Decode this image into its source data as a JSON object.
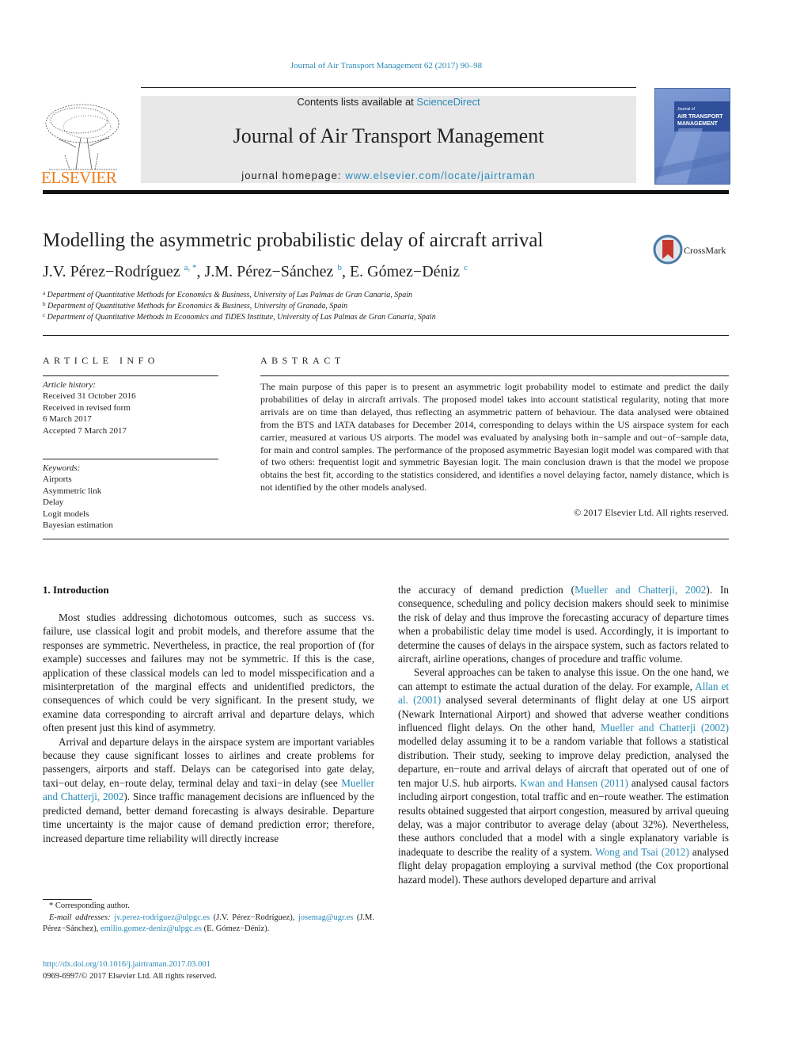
{
  "header": {
    "running_head": "Journal of Air Transport Management 62 (2017) 90–98",
    "contents_prefix": "Contents lists available at ",
    "contents_link": "ScienceDirect",
    "journal_title": "Journal of Air Transport Management",
    "homepage_prefix": "journal homepage: ",
    "homepage_link": "www.elsevier.com/locate/jairtraman",
    "publisher_logo_text": "ELSEVIER",
    "cover_title_small": "Journal of",
    "cover_title": "AIR TRANSPORT MANAGEMENT"
  },
  "article": {
    "title": "Modelling the asymmetric probabilistic delay of aircraft arrival",
    "crossmark_label": "CrossMark",
    "authors": [
      {
        "name": "J.V. Pérez−Rodríguez",
        "sup": "a, *"
      },
      {
        "name": "J.M. Pérez−Sánchez",
        "sup": "b"
      },
      {
        "name": "E. Gómez−Déniz",
        "sup": "c"
      }
    ],
    "affiliations": [
      {
        "key": "a",
        "text": "Department of Quantitative Methods for Economics & Business, University of Las Palmas de Gran Canaria, Spain"
      },
      {
        "key": "b",
        "text": "Department of Quantitative Methods for Economics & Business, University of Granada, Spain"
      },
      {
        "key": "c",
        "text": "Department of Quantitative Methods in Economics and TiDES Institute, University of Las Palmas de Gran Canaria, Spain"
      }
    ]
  },
  "article_info": {
    "heading": "ARTICLE INFO",
    "history_label": "Article history:",
    "history": [
      "Received 31 October 2016",
      "Received in revised form",
      "6 March 2017",
      "Accepted 7 March 2017"
    ],
    "keywords_label": "Keywords:",
    "keywords": [
      "Airports",
      "Asymmetric link",
      "Delay",
      "Logit models",
      "Bayesian estimation"
    ]
  },
  "abstract": {
    "heading": "ABSTRACT",
    "text": "The main purpose of this paper is to present an asymmetric logit probability model to estimate and predict the daily probabilities of delay in aircraft arrivals. The proposed model takes into account statistical regularity, noting that more arrivals are on time than delayed, thus reflecting an asymmetric pattern of behaviour. The data analysed were obtained from the BTS and IATA databases for December 2014, corresponding to delays within the US airspace system for each carrier, measured at various US airports. The model was evaluated by analysing both in−sample and out−of−sample data, for main and control samples. The performance of the proposed asymmetric Bayesian logit model was compared with that of two others: frequentist logit and symmetric Bayesian logit. The main conclusion drawn is that the model we propose obtains the best fit, according to the statistics considered, and identifies a novel delaying factor, namely distance, which is not identified by the other models analysed.",
    "copyright": "© 2017 Elsevier Ltd. All rights reserved."
  },
  "body": {
    "section_heading": "1.  Introduction",
    "left_p1": "Most studies addressing dichotomous outcomes, such as success vs. failure, use classical logit and probit models, and therefore assume that the responses are symmetric. Nevertheless, in practice, the real proportion of (for example) successes and failures may not be symmetric. If this is the case, application of these classical models can led to model misspecification and a misinterpretation of the marginal effects and unidentified predictors, the consequences of which could be very significant. In the present study, we examine data corresponding to aircraft arrival and departure delays, which often present just this kind of asymmetry.",
    "left_p2_a": "Arrival and departure delays in the airspace system are important variables because they cause significant losses to airlines and create problems for passengers, airports and staff. Delays can be categorised into gate delay, taxi−out delay, en−route delay, terminal delay and taxi−in delay (see ",
    "left_p2_link": "Mueller and Chatterji, 2002",
    "left_p2_b": "). Since traffic management decisions are influenced by the predicted demand, better demand forecasting is always desirable. Departure time uncertainty is the major cause of demand prediction error; therefore, increased departure time reliability will directly increase",
    "right_p1_a": "the accuracy of demand prediction (",
    "right_p1_link": "Mueller and Chatterji, 2002",
    "right_p1_b": "). In consequence, scheduling and policy decision makers should seek to minimise the risk of delay and thus improve the forecasting accuracy of departure times when a probabilistic delay time model is used. Accordingly, it is important to determine the causes of delays in the airspace system, such as factors related to aircraft, airline operations, changes of procedure and traffic volume.",
    "right_p2_a": "Several approaches can be taken to analyse this issue. On the one hand, we can attempt to estimate the actual duration of the delay. For example, ",
    "right_p2_link1": "Allan et al. (2001)",
    "right_p2_b": " analysed several determinants of flight delay at one US airport (Newark International Airport) and showed that adverse weather conditions influenced flight delays. On the other hand, ",
    "right_p2_link2": "Mueller and Chatterji (2002)",
    "right_p2_c": " modelled delay assuming it to be a random variable that follows a statistical distribution. Their study, seeking to improve delay prediction, analysed the departure, en−route and arrival delays of aircraft that operated out of one of ten major U.S. hub airports. ",
    "right_p2_link3": "Kwan and Hansen (2011)",
    "right_p2_d": " analysed causal factors including airport congestion, total traffic and en−route weather. The estimation results obtained suggested that airport congestion, measured by arrival queuing delay, was a major contributor to average delay (about 32%). Nevertheless, these authors concluded that a model with a single explanatory variable is inadequate to describe the reality of a system. ",
    "right_p2_link4": "Wong and Tsai (2012)",
    "right_p2_e": " analysed flight delay propagation employing a survival method (the Cox proportional hazard model). These authors developed departure and arrival"
  },
  "footnotes": {
    "corresponding": "* Corresponding author.",
    "email_label": "E-mail addresses:",
    "emails": [
      {
        "addr": "jv.perez-rodriguez@ulpgc.es",
        "who": "(J.V. Pérez−Rodríguez),"
      },
      {
        "addr": "josemag@ugr.es",
        "who": "(J.M. Pérez−Sánchez),"
      },
      {
        "addr": "emilio.gomez-deniz@ulpgc.es",
        "who": "(E. Gómez−Déniz)."
      }
    ],
    "doi": "http://dx.doi.org/10.1016/j.jairtraman.2017.03.001",
    "issn_copyright": "0969-6997/© 2017 Elsevier Ltd. All rights reserved."
  }
}
